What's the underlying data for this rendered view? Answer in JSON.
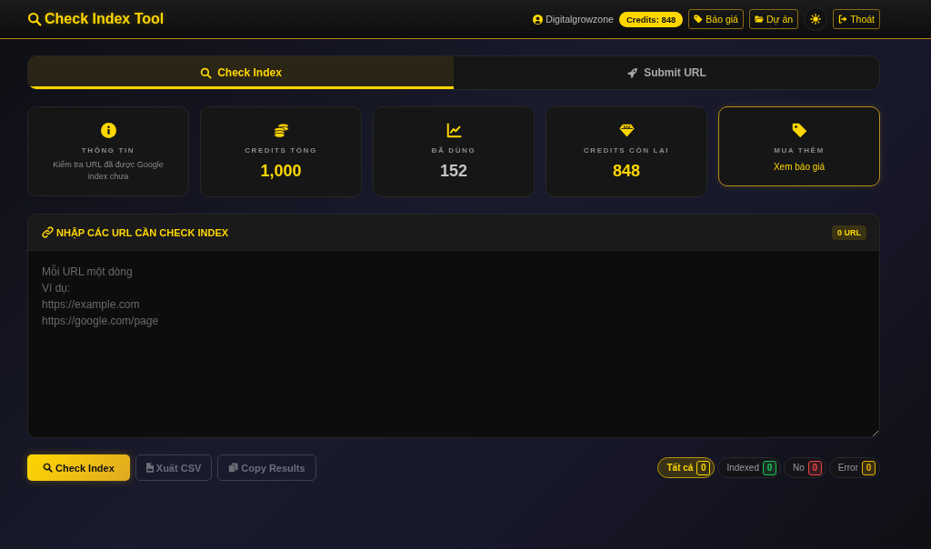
{
  "header": {
    "title": "Check Index Tool",
    "user": "Digitalgrowzone",
    "credits": "Credits: 848",
    "nav_buttons": [
      {
        "label": "Báo giá"
      },
      {
        "label": "Dự án"
      }
    ],
    "logout": "Thoát"
  },
  "tabs": [
    {
      "label": "Check Index",
      "selected": true
    },
    {
      "label": "Submit URL",
      "selected": false
    }
  ],
  "stats": [
    {
      "kind": "info",
      "label": "THÔNG TIN",
      "description": "Kiểm tra URL đã được Google index chưa"
    },
    {
      "kind": "stat",
      "label": "CREDITS TỔNG",
      "value": "1,000",
      "color": "#ffd700"
    },
    {
      "kind": "stat",
      "label": "ĐÃ DÙNG",
      "value": "152",
      "color": "#c4c4c4"
    },
    {
      "kind": "stat",
      "label": "CREDITS CÒN LẠI",
      "value": "848",
      "color": "#ffd700"
    },
    {
      "kind": "link",
      "label": "MUA THÊM",
      "link": "Xem báo giá"
    }
  ],
  "url_panel": {
    "title": "NHẬP CÁC URL CẦN CHECK INDEX",
    "count": "0 URL",
    "placeholder": "Mỗi URL một dòng\nVí dụ:\nhttps://example.com\nhttps://google.com/page"
  },
  "actions": [
    {
      "kind": "primary",
      "label": "Check Index",
      "disabled": false
    },
    {
      "kind": "secondary",
      "label": "Xuất CSV",
      "disabled": true
    },
    {
      "kind": "secondary",
      "label": "Copy Results",
      "disabled": true
    }
  ],
  "filters": [
    {
      "label": "Tất cả",
      "count": "0",
      "color": "#ffd700",
      "selected": true
    },
    {
      "label": "Indexed",
      "count": "0",
      "color": "#22c55e",
      "selected": false
    },
    {
      "label": "No",
      "count": "0",
      "color": "#ef4444",
      "selected": false
    },
    {
      "label": "Error",
      "count": "0",
      "color": "#eab308",
      "selected": false
    }
  ]
}
